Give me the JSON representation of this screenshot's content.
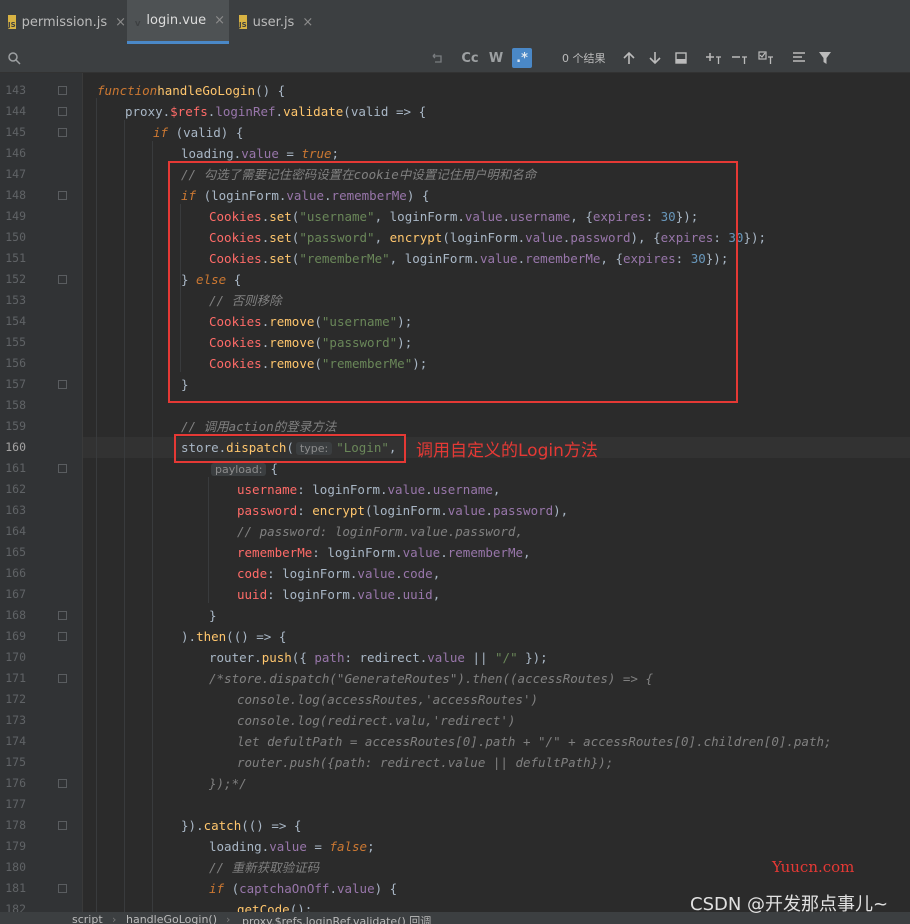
{
  "tabs": [
    {
      "label": "permission.js",
      "icon": "js-file-icon",
      "close": "×",
      "active": false
    },
    {
      "label": "login.vue",
      "icon": "vue-file-icon",
      "close": "×",
      "active": true
    },
    {
      "label": "user.js",
      "icon": "js-file-icon",
      "close": "×",
      "active": false
    }
  ],
  "search": {
    "match_case": "Cc",
    "whole_words": "W",
    "regex": ".*",
    "results": "0 个结果"
  },
  "annotation": "调用自定义的Login方法",
  "watermark": {
    "site": "Yuucn.com",
    "author": "CSDN @开发那点事儿~"
  },
  "breadcrumb": [
    "script",
    "handleGoLogin()",
    "proxy.$refs.loginRef.validate() 回调"
  ],
  "colors": {
    "accent": "#4a88c7",
    "annotation_red": "#e53935"
  },
  "line_numbers": [
    "143",
    "144",
    "145",
    "146",
    "147",
    "148",
    "149",
    "150",
    "151",
    "152",
    "153",
    "154",
    "155",
    "156",
    "157",
    "158",
    "159",
    "160",
    "161",
    "162",
    "163",
    "164",
    "165",
    "166",
    "167",
    "168",
    "169",
    "170",
    "171",
    "172",
    "173",
    "174",
    "175",
    "176",
    "177",
    "178",
    "179",
    "180",
    "181",
    "182"
  ],
  "code": {
    "l143": [
      "function",
      "handleGoLogin",
      "() {"
    ],
    "l144": [
      "proxy.",
      "$refs",
      ".",
      "loginRef",
      ".",
      "validate",
      "(",
      "valid",
      " => {"
    ],
    "l145": [
      "if",
      " (",
      "valid",
      ") {"
    ],
    "l146": [
      "loading.",
      "value",
      " = ",
      "true",
      ";"
    ],
    "l147": "// 勾选了需要记住密码设置在cookie中设置记住用户明和名命",
    "l148": [
      "if",
      " (loginForm.",
      "value",
      ".",
      "rememberMe",
      ") {"
    ],
    "l149": [
      "Cookies",
      ".",
      "set",
      "(",
      "\"username\"",
      ", loginForm.",
      "value",
      ".",
      "username",
      ", {",
      "expires",
      ": ",
      "30",
      "});"
    ],
    "l150": [
      "Cookies",
      ".",
      "set",
      "(",
      "\"password\"",
      ", ",
      "encrypt",
      "(loginForm.",
      "value",
      ".",
      "password",
      "), {",
      "expires",
      ": ",
      "30",
      "});"
    ],
    "l151": [
      "Cookies",
      ".",
      "set",
      "(",
      "\"rememberMe\"",
      ", loginForm.",
      "value",
      ".",
      "rememberMe",
      ", {",
      "expires",
      ": ",
      "30",
      "});"
    ],
    "l152": [
      "}",
      " else ",
      "{"
    ],
    "l153": "// 否则移除",
    "l154": [
      "Cookies",
      ".",
      "remove",
      "(",
      "\"username\"",
      ");"
    ],
    "l155": [
      "Cookies",
      ".",
      "remove",
      "(",
      "\"password\"",
      ");"
    ],
    "l156": [
      "Cookies",
      ".",
      "remove",
      "(",
      "\"rememberMe\"",
      ");"
    ],
    "l157": "}",
    "l159": "// 调用action的登录方法",
    "l160": [
      "store",
      ".",
      "dispatch",
      "(",
      "type:",
      "\"Login\"",
      ","
    ],
    "l161": [
      "payload:",
      "{"
    ],
    "l162": [
      "username",
      ": loginForm.",
      "value",
      ".",
      "username",
      ","
    ],
    "l163": [
      "password",
      ": ",
      "encrypt",
      "(loginForm.",
      "value",
      ".",
      "password",
      "),"
    ],
    "l164": "// password: loginForm.value.password,",
    "l165": [
      "rememberMe",
      ": loginForm.",
      "value",
      ".",
      "rememberMe",
      ","
    ],
    "l166": [
      "code",
      ": loginForm.",
      "value",
      ".",
      "code",
      ","
    ],
    "l167": [
      "uuid",
      ": loginForm.",
      "value",
      ".",
      "uuid",
      ","
    ],
    "l168": "}",
    "l169": [
      ")",
      ".",
      "then",
      "(() => {"
    ],
    "l170": [
      "router",
      ".",
      "push",
      "({ ",
      "path",
      ": redirect.",
      "value",
      " || ",
      "\"/\"",
      " });"
    ],
    "l171": "/*store.dispatch(\"GenerateRoutes\").then((accessRoutes) => {",
    "l172": "console.log(accessRoutes,'accessRoutes')",
    "l173": "console.log(redirect.valu,'redirect')",
    "l174": "let defultPath = accessRoutes[0].path + \"/\" + accessRoutes[0].children[0].path;",
    "l175": "router.push({path: redirect.value || defultPath});",
    "l176": "});*/",
    "l178": [
      "})",
      ".",
      "catch",
      "(() => {"
    ],
    "l179": [
      "loading.",
      "value",
      " = ",
      "false",
      ";"
    ],
    "l180": "// 重新获取验证码",
    "l181": [
      "if",
      " (",
      "captchaOnOff",
      ".",
      "value",
      ") {"
    ],
    "l182": [
      "getCode",
      "();"
    ]
  }
}
